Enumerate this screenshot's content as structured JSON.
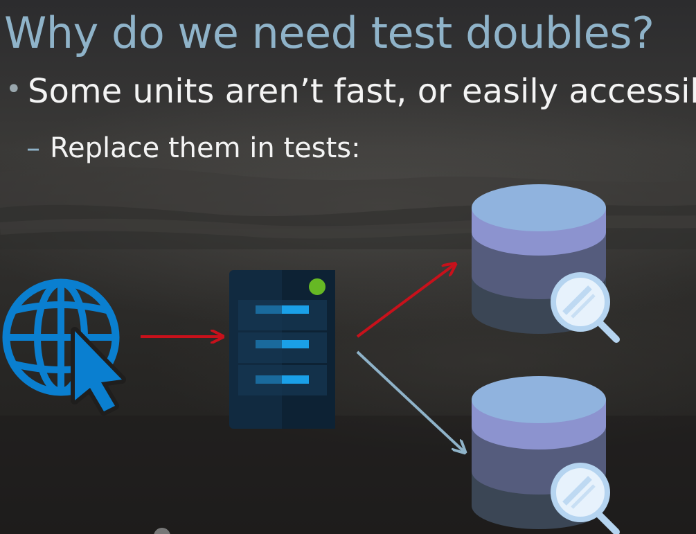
{
  "slide": {
    "title": "Why do we need test doubles?",
    "bullet": {
      "marker": "•",
      "text": "Some units aren’t fast, or easily accessible"
    },
    "sub_bullet": {
      "marker": "–",
      "text": "Replace them in tests:"
    }
  },
  "diagram": {
    "icons": [
      "globe-cursor-icon",
      "server-icon",
      "database-search-icon",
      "database-search-icon"
    ],
    "colors": {
      "globe": "#0a7fd0",
      "server_body": "#123048",
      "server_bar": "#1aa0e8",
      "server_led": "#66b824",
      "arrow_real": "#c8111b",
      "arrow_double": "#8fb3c9",
      "db_top": "#90b3de",
      "db_mid": "#8c93cf",
      "db_low": "#555c7d",
      "db_base": "#3b4655",
      "magnifier_ring": "#b5d4f0",
      "magnifier_lens": "#e7f2fc"
    }
  }
}
